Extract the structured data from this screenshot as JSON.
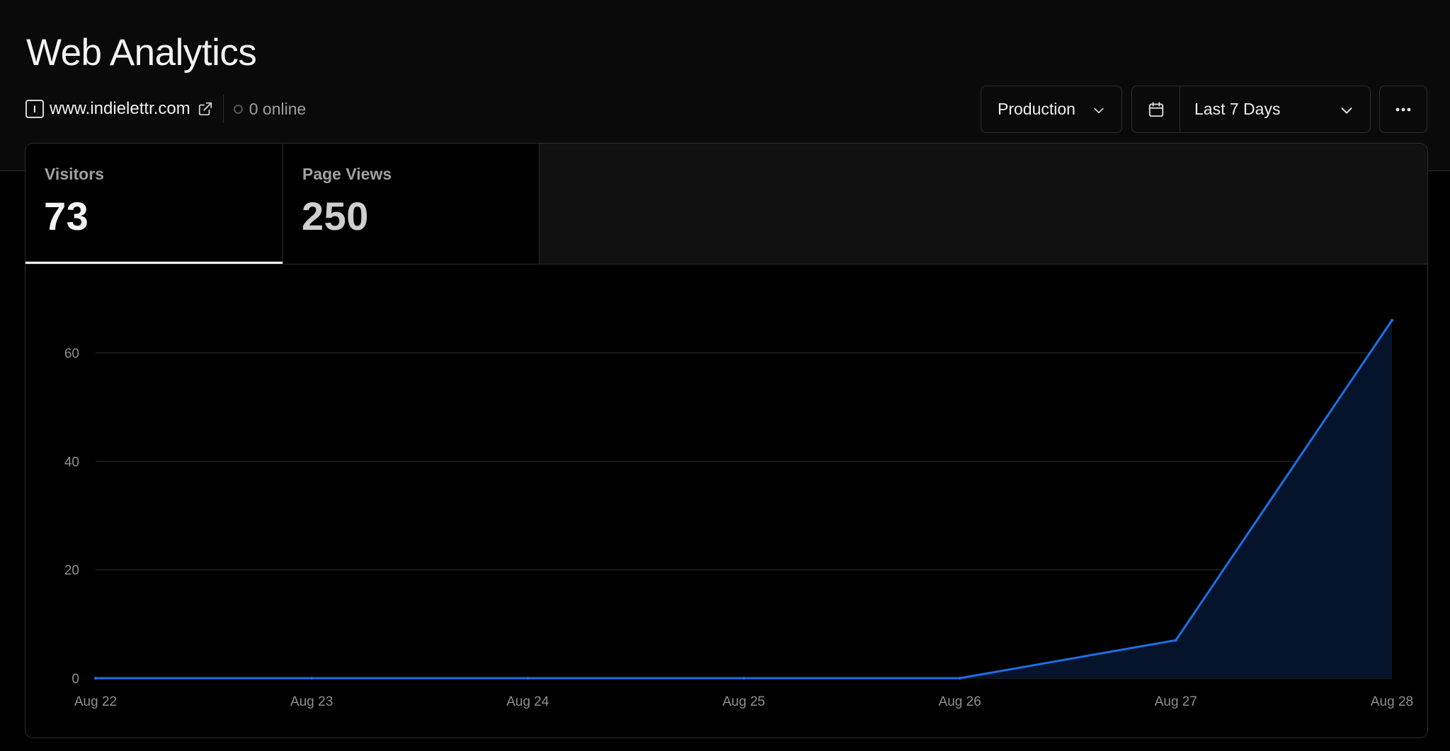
{
  "header": {
    "title": "Web Analytics",
    "site": {
      "domain": "www.indielettr.com",
      "favicon_letter": "I",
      "online_text": "0 online"
    },
    "environment_label": "Production",
    "date_range_label": "Last 7 Days"
  },
  "tabs": [
    {
      "label": "Visitors",
      "value": "73",
      "active": true
    },
    {
      "label": "Page Views",
      "value": "250",
      "active": false
    }
  ],
  "colors": {
    "line": "#1f6fe5",
    "area": "#06142b",
    "grid": "#2a2a2a",
    "active_tab_indicator": "#ffffff"
  },
  "icons": {
    "external": "external-link-icon",
    "calendar": "calendar-icon",
    "chevron": "chevron-down-icon",
    "more": "ellipsis-icon"
  },
  "chart_data": {
    "type": "area",
    "x": [
      "Aug 22",
      "Aug 23",
      "Aug 24",
      "Aug 25",
      "Aug 26",
      "Aug 27",
      "Aug 28"
    ],
    "series": [
      {
        "values": [
          0,
          0,
          0,
          0,
          0,
          7,
          66
        ]
      }
    ],
    "yticks": [
      0,
      20,
      40,
      60
    ],
    "ylim": [
      0,
      66
    ],
    "grid": true
  }
}
